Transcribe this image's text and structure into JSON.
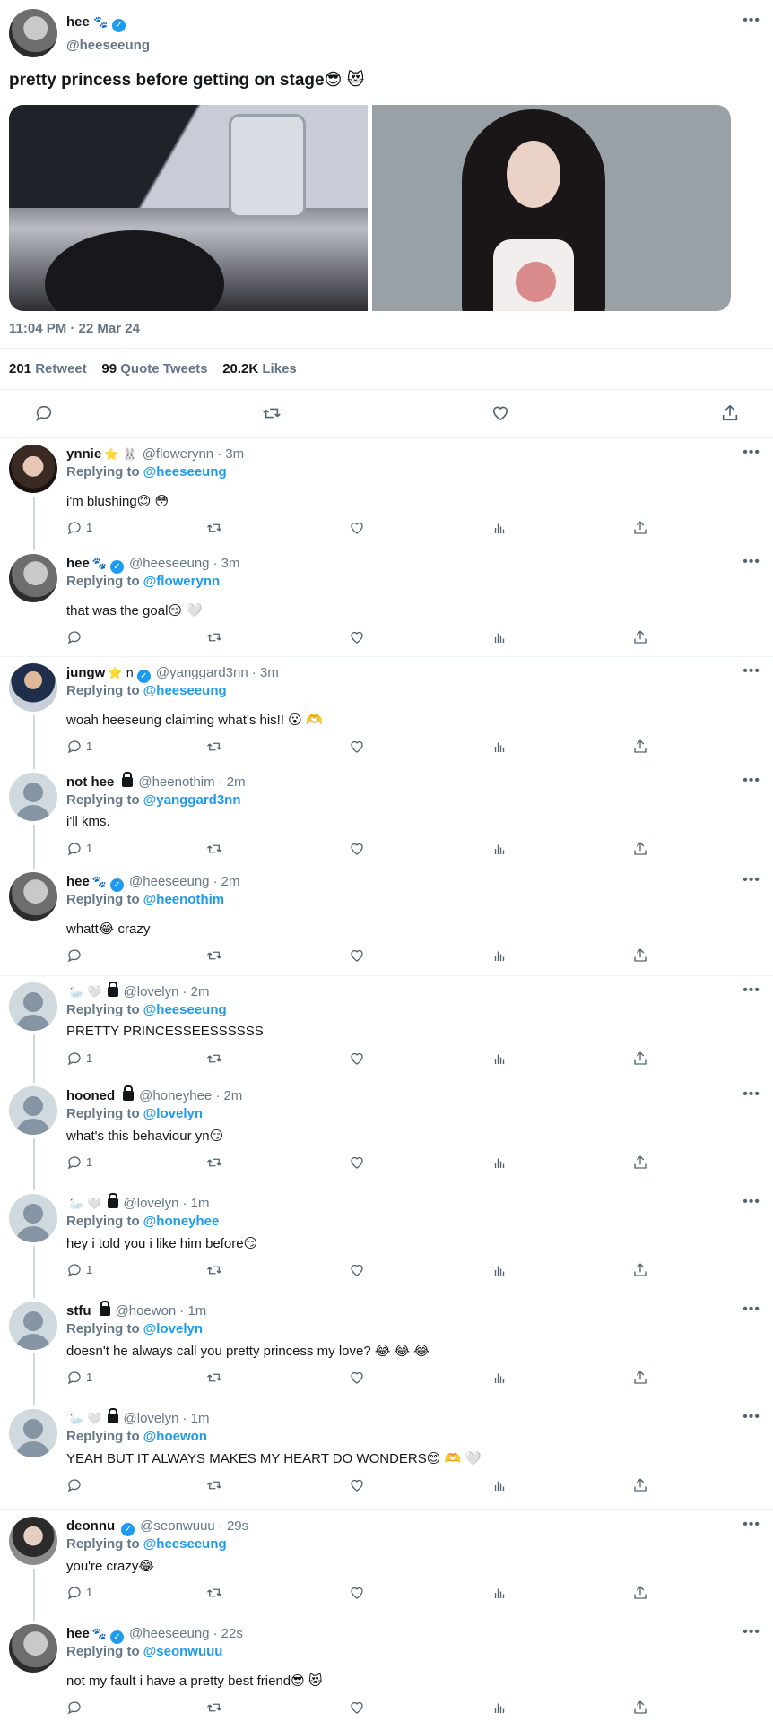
{
  "main_tweet": {
    "name": "hee",
    "name_emoji": "🐾",
    "handle": "@heeseeung",
    "text": "pretty princess before getting on stage😎 😻",
    "timestamp": "11:04 PM · 22 Mar 24",
    "stats": {
      "retweets_count": "201",
      "retweets_label": "Retweet",
      "quotes_count": "99",
      "quotes_label": "Quote Tweets",
      "likes_count": "20.2K",
      "likes_label": "Likes"
    }
  },
  "replies": [
    {
      "name": "ynnie",
      "name_extra": "⭐ 🐰",
      "handle": "@flowerynn",
      "time": "· 3m",
      "replying_label": "Replying to",
      "replying_to": "@heeseeung",
      "text": "i'm blushing😊 😳",
      "reply_count": "1"
    },
    {
      "name": "hee",
      "name_extra": "🐾",
      "handle": "@heeseeung",
      "time": "· 3m",
      "replying_label": "Replying to",
      "replying_to": "@flowerynn",
      "text": "that was the goal😏 🤍",
      "reply_count": ""
    },
    {
      "name": "jungw",
      "name_extra": "⭐ n",
      "handle": "@yanggard3nn",
      "time": "· 3m",
      "replying_label": "Replying to",
      "replying_to": "@heeseeung",
      "text": "woah heeseung claiming what's his!! 😮 🫶",
      "reply_count": "1"
    },
    {
      "name": "not hee",
      "name_extra": "",
      "handle": "@heenothim",
      "time": "· 2m",
      "replying_label": "Replying to",
      "replying_to": "@yanggard3nn",
      "text": "i'll kms.",
      "reply_count": "1"
    },
    {
      "name": "hee",
      "name_extra": "🐾",
      "handle": "@heeseeung",
      "time": "· 2m",
      "replying_label": "Replying to",
      "replying_to": "@heenothim",
      "text": "whatt😂  crazy",
      "reply_count": ""
    },
    {
      "name": "",
      "name_extra": "🦢 🤍",
      "handle": "@lovelyn",
      "time": "· 2m",
      "replying_label": "Replying to",
      "replying_to": "@heeseeung",
      "text": "PRETTY PRINCESSEESSSSSS",
      "reply_count": "1"
    },
    {
      "name": "hooned",
      "name_extra": "",
      "handle": "@honeyhee",
      "time": "· 2m",
      "replying_label": "Replying to",
      "replying_to": "@lovelyn",
      "text": "what's this behaviour yn😏",
      "reply_count": "1"
    },
    {
      "name": "",
      "name_extra": "🦢 🤍",
      "handle": "@lovelyn",
      "time": "· 1m",
      "replying_label": "Replying to",
      "replying_to": "@honeyhee",
      "text": "hey i told you i like him before😏",
      "reply_count": "1"
    },
    {
      "name": "stfu",
      "name_extra": "",
      "handle": "@hoewon",
      "time": "· 1m",
      "replying_label": "Replying to",
      "replying_to": "@lovelyn",
      "text": "doesn't he always call you pretty princess my love? 😂 😂 😂",
      "reply_count": "1"
    },
    {
      "name": "",
      "name_extra": "🦢 🤍",
      "handle": "@lovelyn",
      "time": "· 1m",
      "replying_label": "Replying to",
      "replying_to": "@hoewon",
      "text": "YEAH BUT IT ALWAYS MAKES MY HEART DO WONDERS😊 🫶 🤍",
      "reply_count": ""
    },
    {
      "name": "deonnu",
      "name_extra": "",
      "handle": "@seonwuuu",
      "time": "· 29s",
      "replying_label": "Replying to",
      "replying_to": "@heeseeung",
      "text": "you're crazy😂",
      "reply_count": "1"
    },
    {
      "name": "hee",
      "name_extra": "🐾",
      "handle": "@heeseeung",
      "time": "· 22s",
      "replying_label": "Replying to",
      "replying_to": "@seonwuuu",
      "text": "not my fault i have a pretty best friend😎 😻",
      "reply_count": ""
    }
  ],
  "icons": {
    "reply": "speech-bubble-icon",
    "retweet": "retweet-icon",
    "like": "heart-icon",
    "views": "bar-chart-icon",
    "share": "share-icon",
    "more": "more-dots-icon"
  },
  "colors": {
    "link": "#1d9bf0",
    "muted": "#657786",
    "text": "#14171a"
  }
}
